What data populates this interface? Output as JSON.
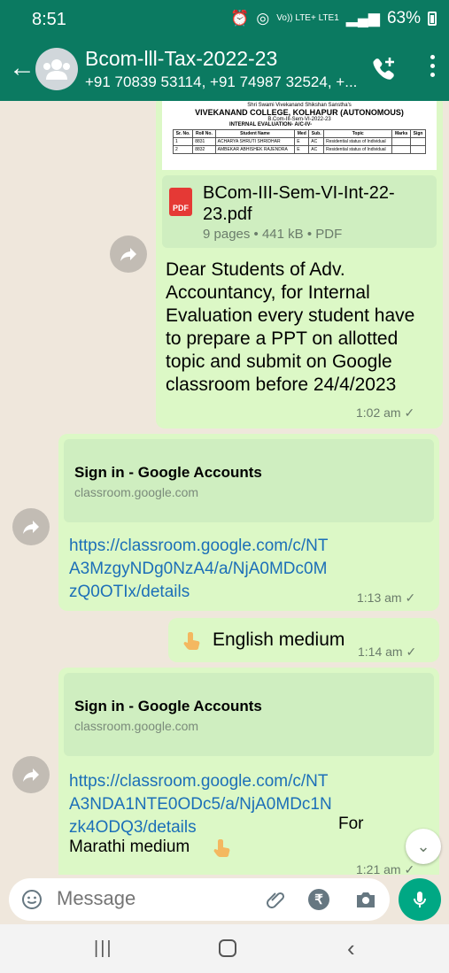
{
  "status": {
    "time": "8:51",
    "network": "Vo)) LTE+ LTE1",
    "battery": "63%"
  },
  "header": {
    "title": "Bcom-lll-Tax-2022-23",
    "subtitle": "+91 70839 53114, +91 74987 32524, +..."
  },
  "messages": {
    "doc": {
      "thumb_org": "Shri Swami Vivekanand Shikshan Sanstha's",
      "thumb_college": "VIVEKANAND COLLEGE, KOLHAPUR (AUTONOMOUS)",
      "thumb_class": "B.Com-III-Sem-VI-2022-23",
      "thumb_eval": "INTERNAL EVALUATION- A/C-IV-",
      "thumb_headers": [
        "Sr. No.",
        "Roll No.",
        "Student Name",
        "Med",
        "Sub.",
        "Topic",
        "Marks",
        "Sign"
      ],
      "thumb_rows": [
        [
          "1",
          "8831",
          "ACHARYA SHRUTI SHRIDHAR",
          "E",
          "AC",
          "Residential status of Individual",
          "",
          ""
        ],
        [
          "2",
          "8832",
          "AMBEKAR ABHISHEK RAJENDRA",
          "E",
          "AC",
          "Residential status of Individual",
          "",
          ""
        ]
      ],
      "name": "BCom-III-Sem-VI-Int-22-23.pdf",
      "meta": "9 pages • 441 kB • PDF",
      "pdf_label": "PDF",
      "text": "Dear Students of Adv. Accountancy, for Internal Evaluation every student have to prepare a PPT on allotted topic and submit on Google classroom before 24/4/2023",
      "time": "1:02 am"
    },
    "link1": {
      "preview_title": "Sign in - Google Accounts",
      "preview_domain": "classroom.google.com",
      "url": "https://classroom.google.com/c/NTA3MzgyNDg0NzA4/a/NjA0MDc0MzQ0OTIx/details",
      "time": "1:13 am"
    },
    "english": {
      "text": "English medium",
      "time": "1:14 am"
    },
    "link2": {
      "preview_title": "Sign in - Google Accounts",
      "preview_domain": "classroom.google.com",
      "url": "https://classroom.google.com/c/NTA3NDA1NTE0ODc5/a/NjA0MDc1Nzk4ODQ3/details",
      "suffix": "For Marathi medium",
      "time": "1:21 am"
    }
  },
  "input": {
    "placeholder": "Message"
  },
  "colors": {
    "header": "#0b7a61",
    "bubble": "#dcf8c6",
    "accent": "#00a884",
    "link": "#1c6fb8"
  }
}
